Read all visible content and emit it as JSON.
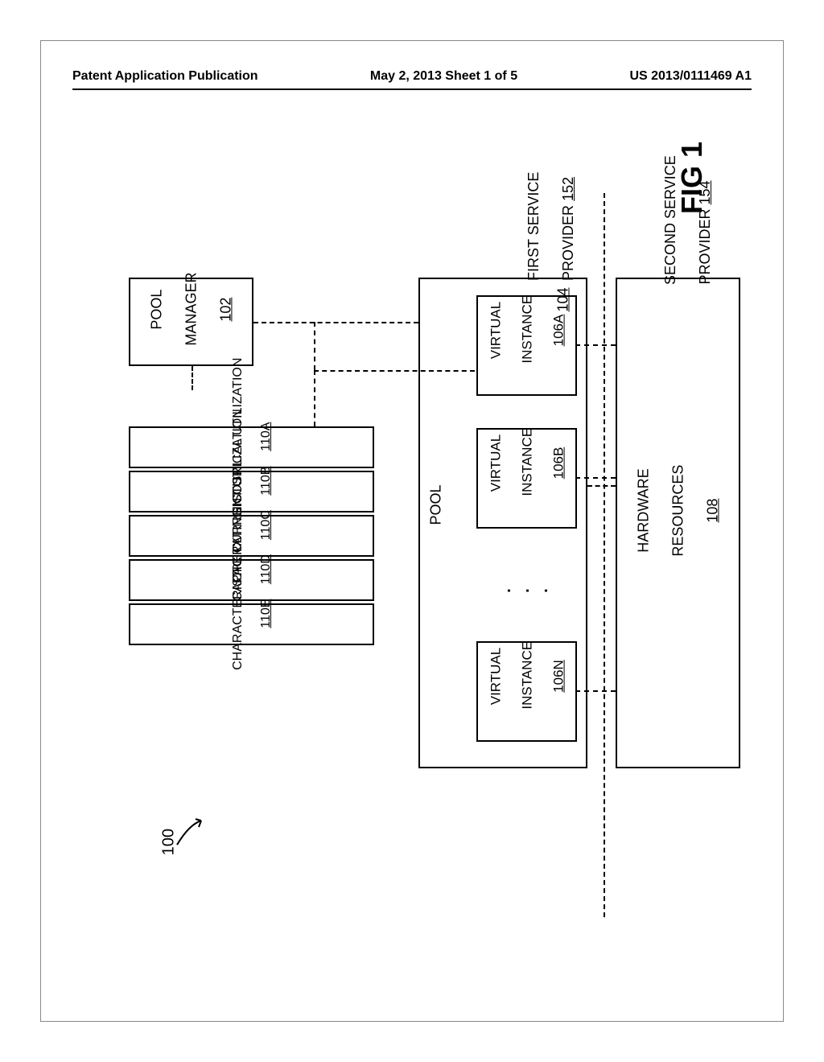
{
  "header": {
    "left": "Patent Application Publication",
    "center": "May 2, 2013  Sheet 1 of 5",
    "right": "US 2013/0111469 A1"
  },
  "figure_label": "FIG 1",
  "figure_number": "100",
  "first_service": {
    "line1": "FIRST SERVICE",
    "line2": "PROVIDER",
    "ref": "152"
  },
  "second_service": {
    "line1": "SECOND SERVICE",
    "line2": "PROVIDER",
    "ref": "154"
  },
  "hardware": {
    "line1": "HARDWARE",
    "line2": "RESOURCES",
    "ref": "108"
  },
  "pool_manager": {
    "line1": "POOL",
    "line2": "MANAGER",
    "ref": "102"
  },
  "pool": {
    "label": "POOL",
    "ref": "104"
  },
  "virtual_instances": [
    {
      "line1": "VIRTUAL",
      "line2": "INSTANCE",
      "ref": "106A"
    },
    {
      "line1": "VIRTUAL",
      "line2": "INSTANCE",
      "ref": "106B"
    },
    {
      "line1": "VIRTUAL",
      "line2": "INSTANCE",
      "ref": "106N"
    }
  ],
  "dots": "·\n·\n·",
  "metrics": [
    {
      "label": "HISTORICAL UTILIZATION",
      "ref": "110A"
    },
    {
      "label": "CURRENT UTILIZATION",
      "ref": "110B"
    },
    {
      "label": "OPERATING COST",
      "ref": "110C"
    },
    {
      "label": "CAPACITY",
      "ref": "110D"
    },
    {
      "label": "CHARACTERISTIC",
      "ref": "110E"
    }
  ]
}
